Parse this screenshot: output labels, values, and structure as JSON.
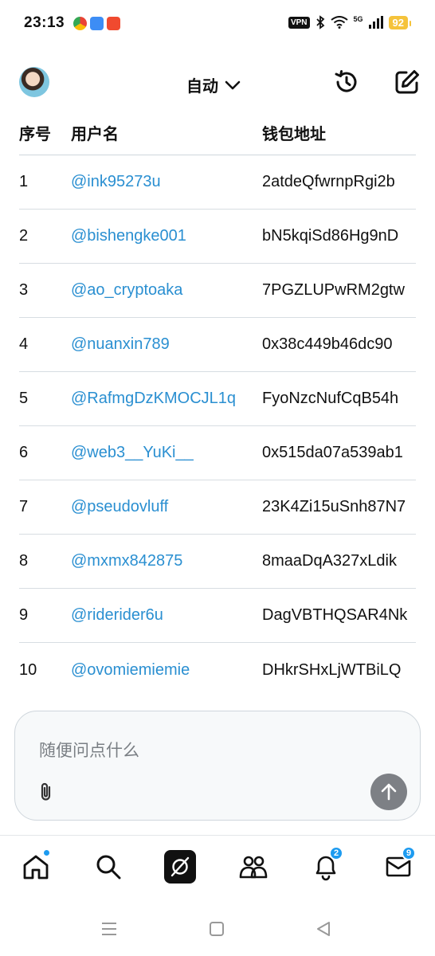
{
  "status_bar": {
    "time": "23:13",
    "vpn": "VPN",
    "network": "5G",
    "battery": "92"
  },
  "top_bar": {
    "mode_label": "自动"
  },
  "table": {
    "headers": [
      "序号",
      "用户名",
      "钱包地址"
    ],
    "rows": [
      {
        "idx": "1",
        "user": "@ink95273u",
        "wallet": "2atdeQfwrnpRgi2b"
      },
      {
        "idx": "2",
        "user": "@bishengke001",
        "wallet": "bN5kqiSd86Hg9nD"
      },
      {
        "idx": "3",
        "user": "@ao_cryptoaka",
        "wallet": "7PGZLUPwRM2gtw"
      },
      {
        "idx": "4",
        "user": "@nuanxin789",
        "wallet": "0x38c449b46dc90"
      },
      {
        "idx": "5",
        "user": "@RafmgDzKMOCJL1q",
        "wallet": "FyoNzcNufCqB54h"
      },
      {
        "idx": "6",
        "user": "@web3__YuKi__",
        "wallet": "0x515da07a539ab1"
      },
      {
        "idx": "7",
        "user": "@pseudovluff",
        "wallet": "23K4Zi15uSnh87N7"
      },
      {
        "idx": "8",
        "user": "@mxmx842875",
        "wallet": "8maaDqA327xLdik"
      },
      {
        "idx": "9",
        "user": "@riderider6u",
        "wallet": "DagVBTHQSAR4Nk"
      },
      {
        "idx": "10",
        "user": "@ovomiemiemie",
        "wallet": "DHkrSHxLjWTBiLQ"
      }
    ]
  },
  "composer": {
    "placeholder": "随便问点什么"
  },
  "bottom_nav": {
    "notifications_badge": "2",
    "messages_badge": "9"
  },
  "colors": {
    "link": "#2a8fd1",
    "accent": "#1d9bf0",
    "battery": "#f5c33b"
  }
}
